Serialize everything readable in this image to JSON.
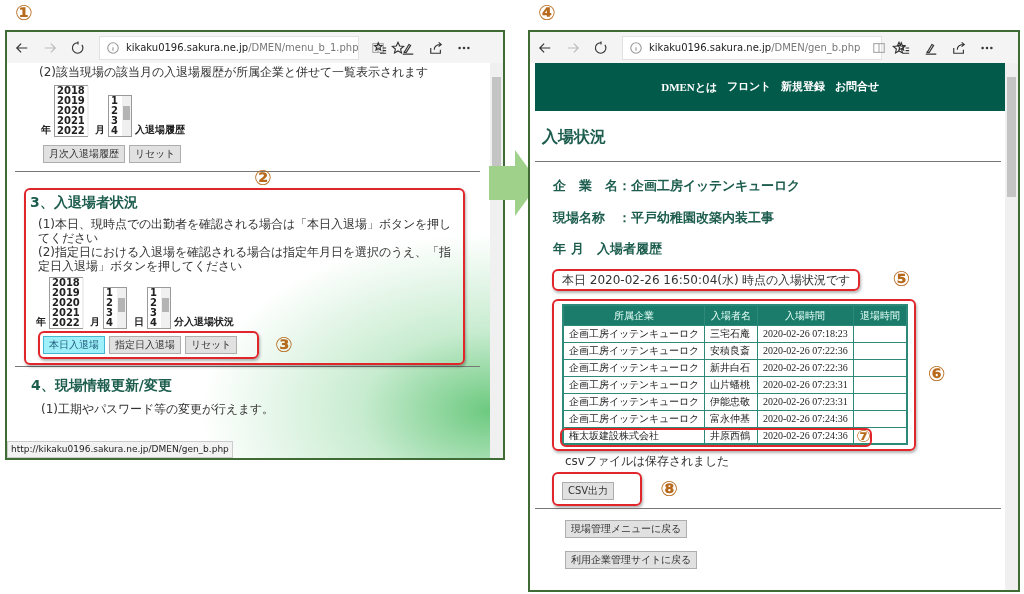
{
  "left_window": {
    "callout": "①",
    "url_host": "kikaku0196.sakura.ne.jp",
    "url_path": "/DMEN/menu_b_1.php",
    "forward_disabled": true,
    "monthly": {
      "note": "(2)該当現場の該当月の入退場履歴が所属企業と併せて一覧表示されます",
      "year_label": "年",
      "year_options": [
        "2018",
        "2019",
        "2020",
        "2021",
        "2022"
      ],
      "month_label": "月",
      "month_options": [
        "1",
        "2",
        "3",
        "4"
      ],
      "suffix": "入退場履歴",
      "buttons": [
        {
          "label": "月次入退場履歴",
          "selected": false
        },
        {
          "label": "リセット",
          "selected": false
        }
      ]
    },
    "status_section": {
      "callout": "②",
      "heading": "3、入退場者状況",
      "notes": [
        "(1)本日、現時点での出勤者を確認される場合は「本日入退場」ボタンを押してください",
        "(2)指定日における入退場を確認される場合は指定年月日を選択のうえ、「指定日入退場」ボタンを押してください"
      ],
      "year_label": "年",
      "year_options": [
        "2018",
        "2019",
        "2020",
        "2021",
        "2022"
      ],
      "month_label": "月",
      "month_options": [
        "1",
        "2",
        "3",
        "4"
      ],
      "day_label": "日",
      "day_options": [
        "1",
        "2",
        "3",
        "4"
      ],
      "suffix": "分入退場状況",
      "buttons_callout": "③",
      "buttons": [
        {
          "label": "本日入退場",
          "selected": true
        },
        {
          "label": "指定日入退場",
          "selected": false
        },
        {
          "label": "リセット",
          "selected": false
        }
      ]
    },
    "update_section": {
      "heading": "4、現場情報更新/変更",
      "note": "(1)工期やパスワード等の変更が行えます。"
    },
    "status_url": "http://kikaku0196.sakura.ne.jp/DMEN/gen_b.php"
  },
  "right_window": {
    "callout": "④",
    "url_host": "kikaku0196.sakura.ne.jp",
    "url_path": "/DMEN/gen_b.php",
    "forward_disabled": true,
    "nav": [
      "DMENとは",
      "フロント",
      "新規登録",
      "お問合せ"
    ],
    "title": "入場状況",
    "fields": [
      "企　業　名：企画工房イッテンキューロク",
      "現場名称　：平戸幼稚園改築内装工事",
      "年 月　入場者履歴"
    ],
    "status_callout": "⑤",
    "status_text": "本日 2020-02-26 16:50:04(水) 時点の入場状況です",
    "table": {
      "callout": "⑥",
      "row_callout": "⑦",
      "columns": [
        "所属企業",
        "入場者名",
        "入場時間",
        "退場時間"
      ],
      "rows": [
        {
          "company": "企画工房イッテンキューロク",
          "name": "三宅石庵",
          "entered": "2020-02-26 07:18:23",
          "highlighted": false
        },
        {
          "company": "企画工房イッテンキューロク",
          "name": "安積良斎",
          "entered": "2020-02-26 07:22:36",
          "highlighted": false
        },
        {
          "company": "企画工房イッテンキューロク",
          "name": "新井白石",
          "entered": "2020-02-26 07:22:36",
          "highlighted": false
        },
        {
          "company": "企画工房イッテンキューロク",
          "name": "山片蟠桃",
          "entered": "2020-02-26 07:23:31",
          "highlighted": false
        },
        {
          "company": "企画工房イッテンキューロク",
          "name": "伊能忠敬",
          "entered": "2020-02-26 07:23:31",
          "highlighted": false
        },
        {
          "company": "企画工房イッテンキューロク",
          "name": "富永仲基",
          "entered": "2020-02-26 07:24:36",
          "highlighted": false
        },
        {
          "company": "権太坂建設株式会社",
          "name": "井原西鶴",
          "entered": "2020-02-26 07:24:36",
          "highlighted": true
        }
      ]
    },
    "save_note": "csvファイルは保存されました",
    "csv_button": {
      "label": "CSV出力",
      "callout": "⑧"
    },
    "back_buttons": [
      "現場管理メニューに戻る",
      "利用企業管理サイトに戻る"
    ]
  }
}
